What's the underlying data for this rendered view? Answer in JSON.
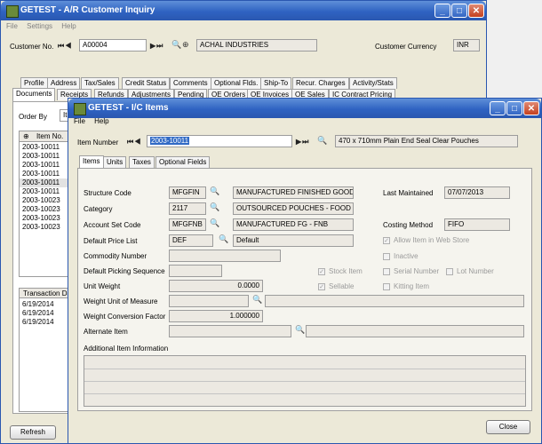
{
  "back": {
    "title": "GETEST - A/R Customer Inquiry",
    "menu": [
      "File",
      "Settings",
      "Help"
    ],
    "customer_label": "Customer No.",
    "customer_value": "A00004",
    "customer_name": "ACHAL INDUSTRIES",
    "currency_label": "Customer Currency",
    "currency_value": "INR",
    "tabs_row1": [
      "Profile",
      "Address",
      "Tax/Sales",
      "Credit Status",
      "Comments",
      "Optional Flds.",
      "Ship-To",
      "Recur. Charges",
      "Activity/Stats"
    ],
    "tabs_row2": [
      "Documents",
      "Receipts",
      "Refunds",
      "Adjustments",
      "Pending",
      "OE Orders",
      "OE Invoices",
      "OE Sales",
      "IC Contract Pricing"
    ],
    "order_by_label": "Order By",
    "order_by_value": "Ite",
    "list_header": "Item No.",
    "list_items": [
      "2003-10011",
      "2003-10011",
      "2003-10011",
      "2003-10011",
      "2003-10011",
      "2003-10011",
      "2003-10023",
      "2003-10023",
      "2003-10023",
      "2003-10023"
    ],
    "txn_header": "Transaction Da",
    "txn_items": [
      "6/19/2014",
      "6/19/2014",
      "6/19/2014"
    ],
    "refresh_label": "Refresh"
  },
  "front": {
    "title": "GETEST - I/C Items",
    "menu": [
      "File",
      "Help"
    ],
    "item_number_label": "Item Number",
    "item_number_value": "2003-10011",
    "item_description": "470 x 710mm Plain End Seal Clear Pouches",
    "tabs": [
      "Items",
      "Units",
      "Taxes",
      "Optional Fields"
    ],
    "structure_code_label": "Structure Code",
    "structure_code_value": "MFGFIN",
    "structure_code_desc": "MANUFACTURED FINISHED GOODS",
    "category_label": "Category",
    "category_value": "2117",
    "category_desc": "OUTSOURCED POUCHES  - FOOD PKG",
    "account_set_label": "Account Set Code",
    "account_set_value": "MFGFNB",
    "account_set_desc": "MANUFACTURED FG - FNB",
    "price_list_label": "Default Price List",
    "price_list_value": "DEF",
    "price_list_desc": "Default",
    "commodity_label": "Commodity Number",
    "picking_label": "Default Picking Sequence",
    "unit_weight_label": "Unit Weight",
    "unit_weight_value": "0.0000",
    "weight_uom_label": "Weight Unit of Measure",
    "weight_factor_label": "Weight Conversion Factor",
    "weight_factor_value": "1.000000",
    "alternate_label": "Alternate Item",
    "last_maintained_label": "Last Maintained",
    "last_maintained_value": "07/07/2013",
    "costing_label": "Costing Method",
    "costing_value": "FIFO",
    "allow_web_label": "Allow Item in Web Store",
    "inactive_label": "Inactive",
    "stock_item_label": "Stock Item",
    "serial_label": "Serial Number",
    "lot_label": "Lot Number",
    "sellable_label": "Sellable",
    "kitting_label": "Kitting Item",
    "additional_info_label": "Additional Item Information",
    "close_label": "Close"
  }
}
